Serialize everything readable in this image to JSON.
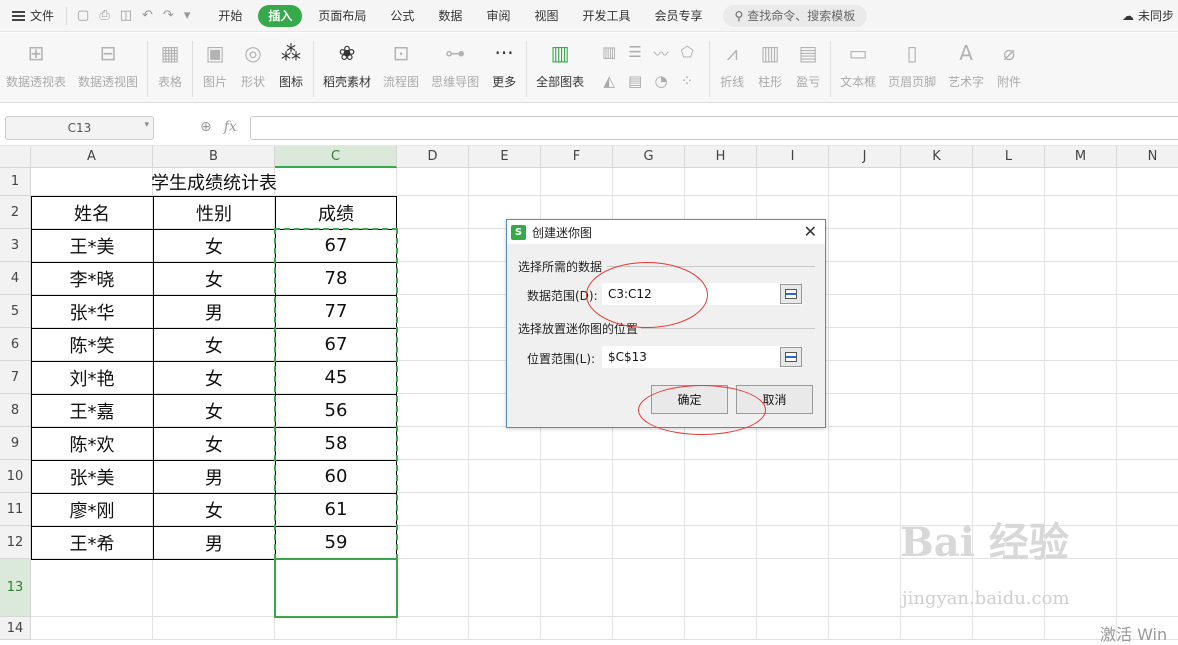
{
  "menubar": {
    "file_label": "文件",
    "tabs": [
      "开始",
      "插入",
      "页面布局",
      "公式",
      "数据",
      "审阅",
      "视图",
      "开发工具",
      "会员专享"
    ],
    "active_tab": "插入",
    "search_placeholder": "查找命令、搜索模板",
    "sync_label": "未同步"
  },
  "ribbon": {
    "pivot_table": "数据透视表",
    "pivot_chart": "数据透视图",
    "table": "表格",
    "picture": "图片",
    "shape": "形状",
    "icon": "图标",
    "daoke": "稻壳素材",
    "flowchart": "流程图",
    "mindmap": "思维导图",
    "more": "更多",
    "all_charts": "全部图表",
    "line": "折线",
    "column": "柱形",
    "winloss": "盈亏",
    "textbox": "文本框",
    "header_footer": "页眉页脚",
    "wordart": "艺术字",
    "attachment": "附件"
  },
  "formula_bar": {
    "name_box": "C13",
    "fx": "fx",
    "content": ""
  },
  "columns": [
    "A",
    "B",
    "C",
    "D",
    "E",
    "F",
    "G",
    "H",
    "I",
    "J",
    "K",
    "L",
    "M",
    "N"
  ],
  "rows": [
    "1",
    "2",
    "3",
    "4",
    "5",
    "6",
    "7",
    "8",
    "9",
    "10",
    "11",
    "12",
    "13",
    "14"
  ],
  "sheet": {
    "title": "学生成绩统计表",
    "headers": [
      "姓名",
      "性别",
      "成绩"
    ],
    "records": [
      [
        "王*美",
        "女",
        "67"
      ],
      [
        "李*晓",
        "女",
        "78"
      ],
      [
        "张*华",
        "男",
        "77"
      ],
      [
        "陈*笑",
        "女",
        "67"
      ],
      [
        "刘*艳",
        "女",
        "45"
      ],
      [
        "王*嘉",
        "女",
        "56"
      ],
      [
        "陈*欢",
        "女",
        "58"
      ],
      [
        "张*美",
        "男",
        "60"
      ],
      [
        "廖*刚",
        "女",
        "61"
      ],
      [
        "王*希",
        "男",
        "59"
      ]
    ]
  },
  "dialog": {
    "title": "创建迷你图",
    "icon_letter": "S",
    "section_data": "选择所需的数据",
    "data_range_label": "数据范围(D):",
    "data_range_value": "C3:C12",
    "section_location": "选择放置迷你图的位置",
    "location_label": "位置范围(L):",
    "location_value": "$C$13",
    "ok": "确定",
    "cancel": "取消"
  },
  "watermark": {
    "logo": "Bai 经验",
    "url": "jingyan.baidu.com",
    "activate": "激活 Win"
  },
  "colors": {
    "accent": "#36a94b",
    "annotation": "#e53935",
    "dialog_border": "#4a90c8"
  }
}
